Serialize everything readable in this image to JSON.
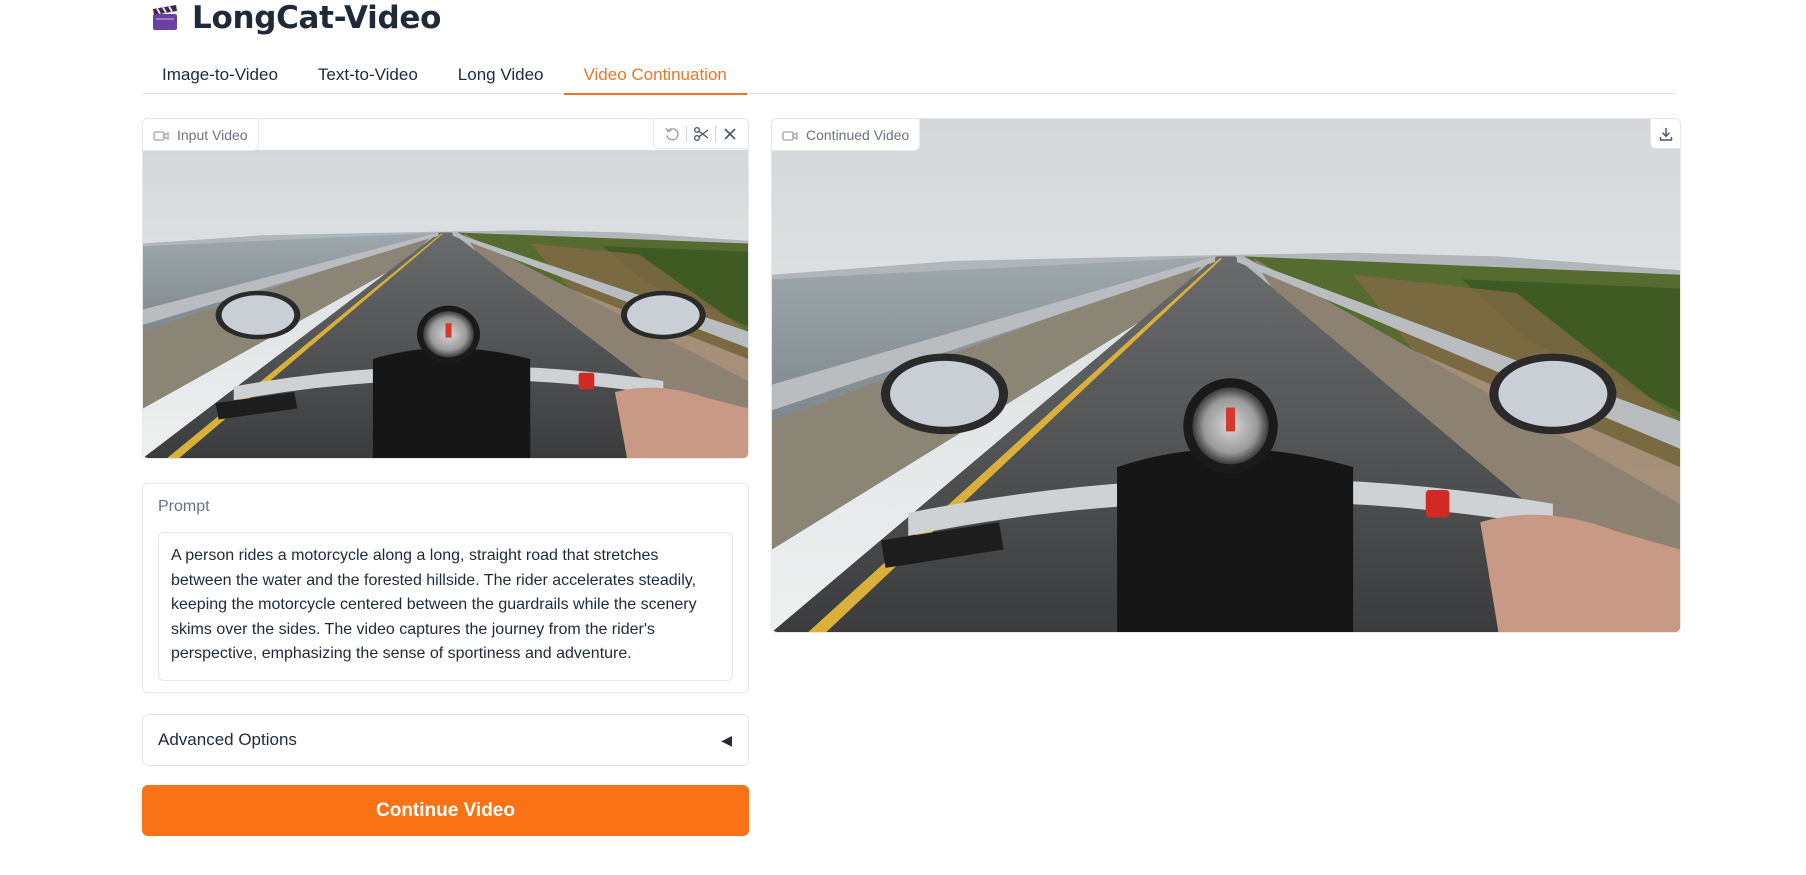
{
  "app": {
    "title": "LongCat-Video",
    "title_icon": "clapperboard-icon"
  },
  "tabs": [
    {
      "label": "Image-to-Video",
      "active": false
    },
    {
      "label": "Text-to-Video",
      "active": false
    },
    {
      "label": "Long Video",
      "active": false
    },
    {
      "label": "Video Continuation",
      "active": true
    }
  ],
  "input_video": {
    "label": "Input Video",
    "label_icon": "video-camera-icon",
    "tools": [
      "undo-icon",
      "scissors-icon",
      "close-icon"
    ]
  },
  "continued_video": {
    "label": "Continued Video",
    "label_icon": "video-camera-icon",
    "tools": [
      "download-icon"
    ]
  },
  "prompt": {
    "label": "Prompt",
    "value": "A person rides a motorcycle along a long, straight road that stretches between the water and the forested hillside. The rider accelerates steadily, keeping the motorcycle centered between the guardrails while the scenery skims over the sides. The video captures the journey from the rider's perspective, emphasizing the sense of sportiness and adventure."
  },
  "advanced": {
    "label": "Advanced Options",
    "caret": "◀"
  },
  "actions": {
    "continue_label": "Continue Video"
  },
  "colors": {
    "accent": "#e8772e",
    "primary_button": "#f97316",
    "border": "#e5e7eb"
  }
}
